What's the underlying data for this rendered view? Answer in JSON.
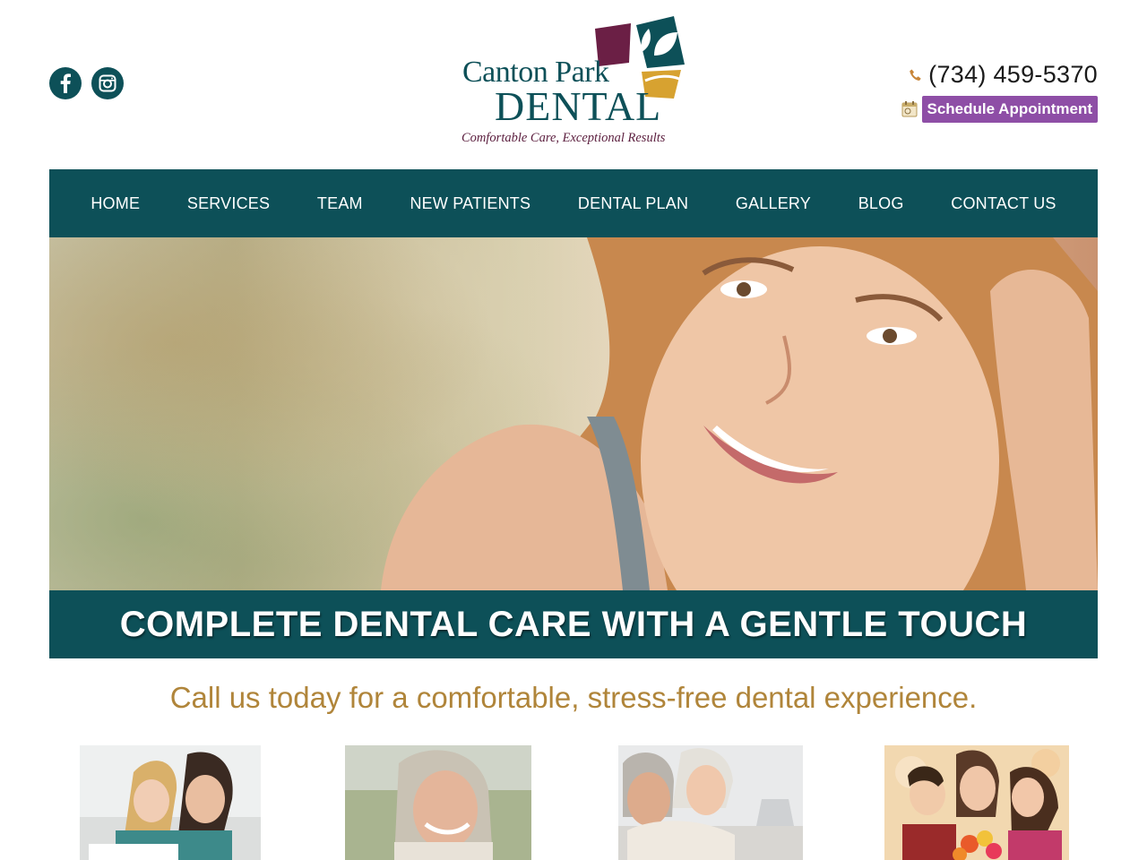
{
  "header": {
    "social": [
      {
        "name": "facebook",
        "icon": "facebook-icon"
      },
      {
        "name": "instagram",
        "icon": "instagram-icon"
      }
    ],
    "logo": {
      "line1": "Canton Park",
      "line2": "DENTAL",
      "tagline": "Comfortable Care, Exceptional Results"
    },
    "phone": "(734) 459-5370",
    "phone_icon": "phone-icon",
    "schedule_label": "Schedule Appointment",
    "schedule_icon": "calendar-icon"
  },
  "nav": {
    "items": [
      {
        "label": "HOME"
      },
      {
        "label": "SERVICES"
      },
      {
        "label": "TEAM"
      },
      {
        "label": "NEW PATIENTS"
      },
      {
        "label": "DENTAL PLAN"
      },
      {
        "label": "GALLERY"
      },
      {
        "label": "BLOG"
      },
      {
        "label": "CONTACT US"
      }
    ]
  },
  "hero": {
    "banner": "COMPLETE DENTAL CARE WITH A GENTLE TOUCH"
  },
  "tagline": "Call us today for a comfortable, stress-free dental experience.",
  "colors": {
    "brand_teal": "#0d5058",
    "accent_purple": "#8e4ea6",
    "tagline_gold": "#b0853a",
    "logo_maroon": "#6b1f45",
    "logo_gold": "#d7a230"
  }
}
